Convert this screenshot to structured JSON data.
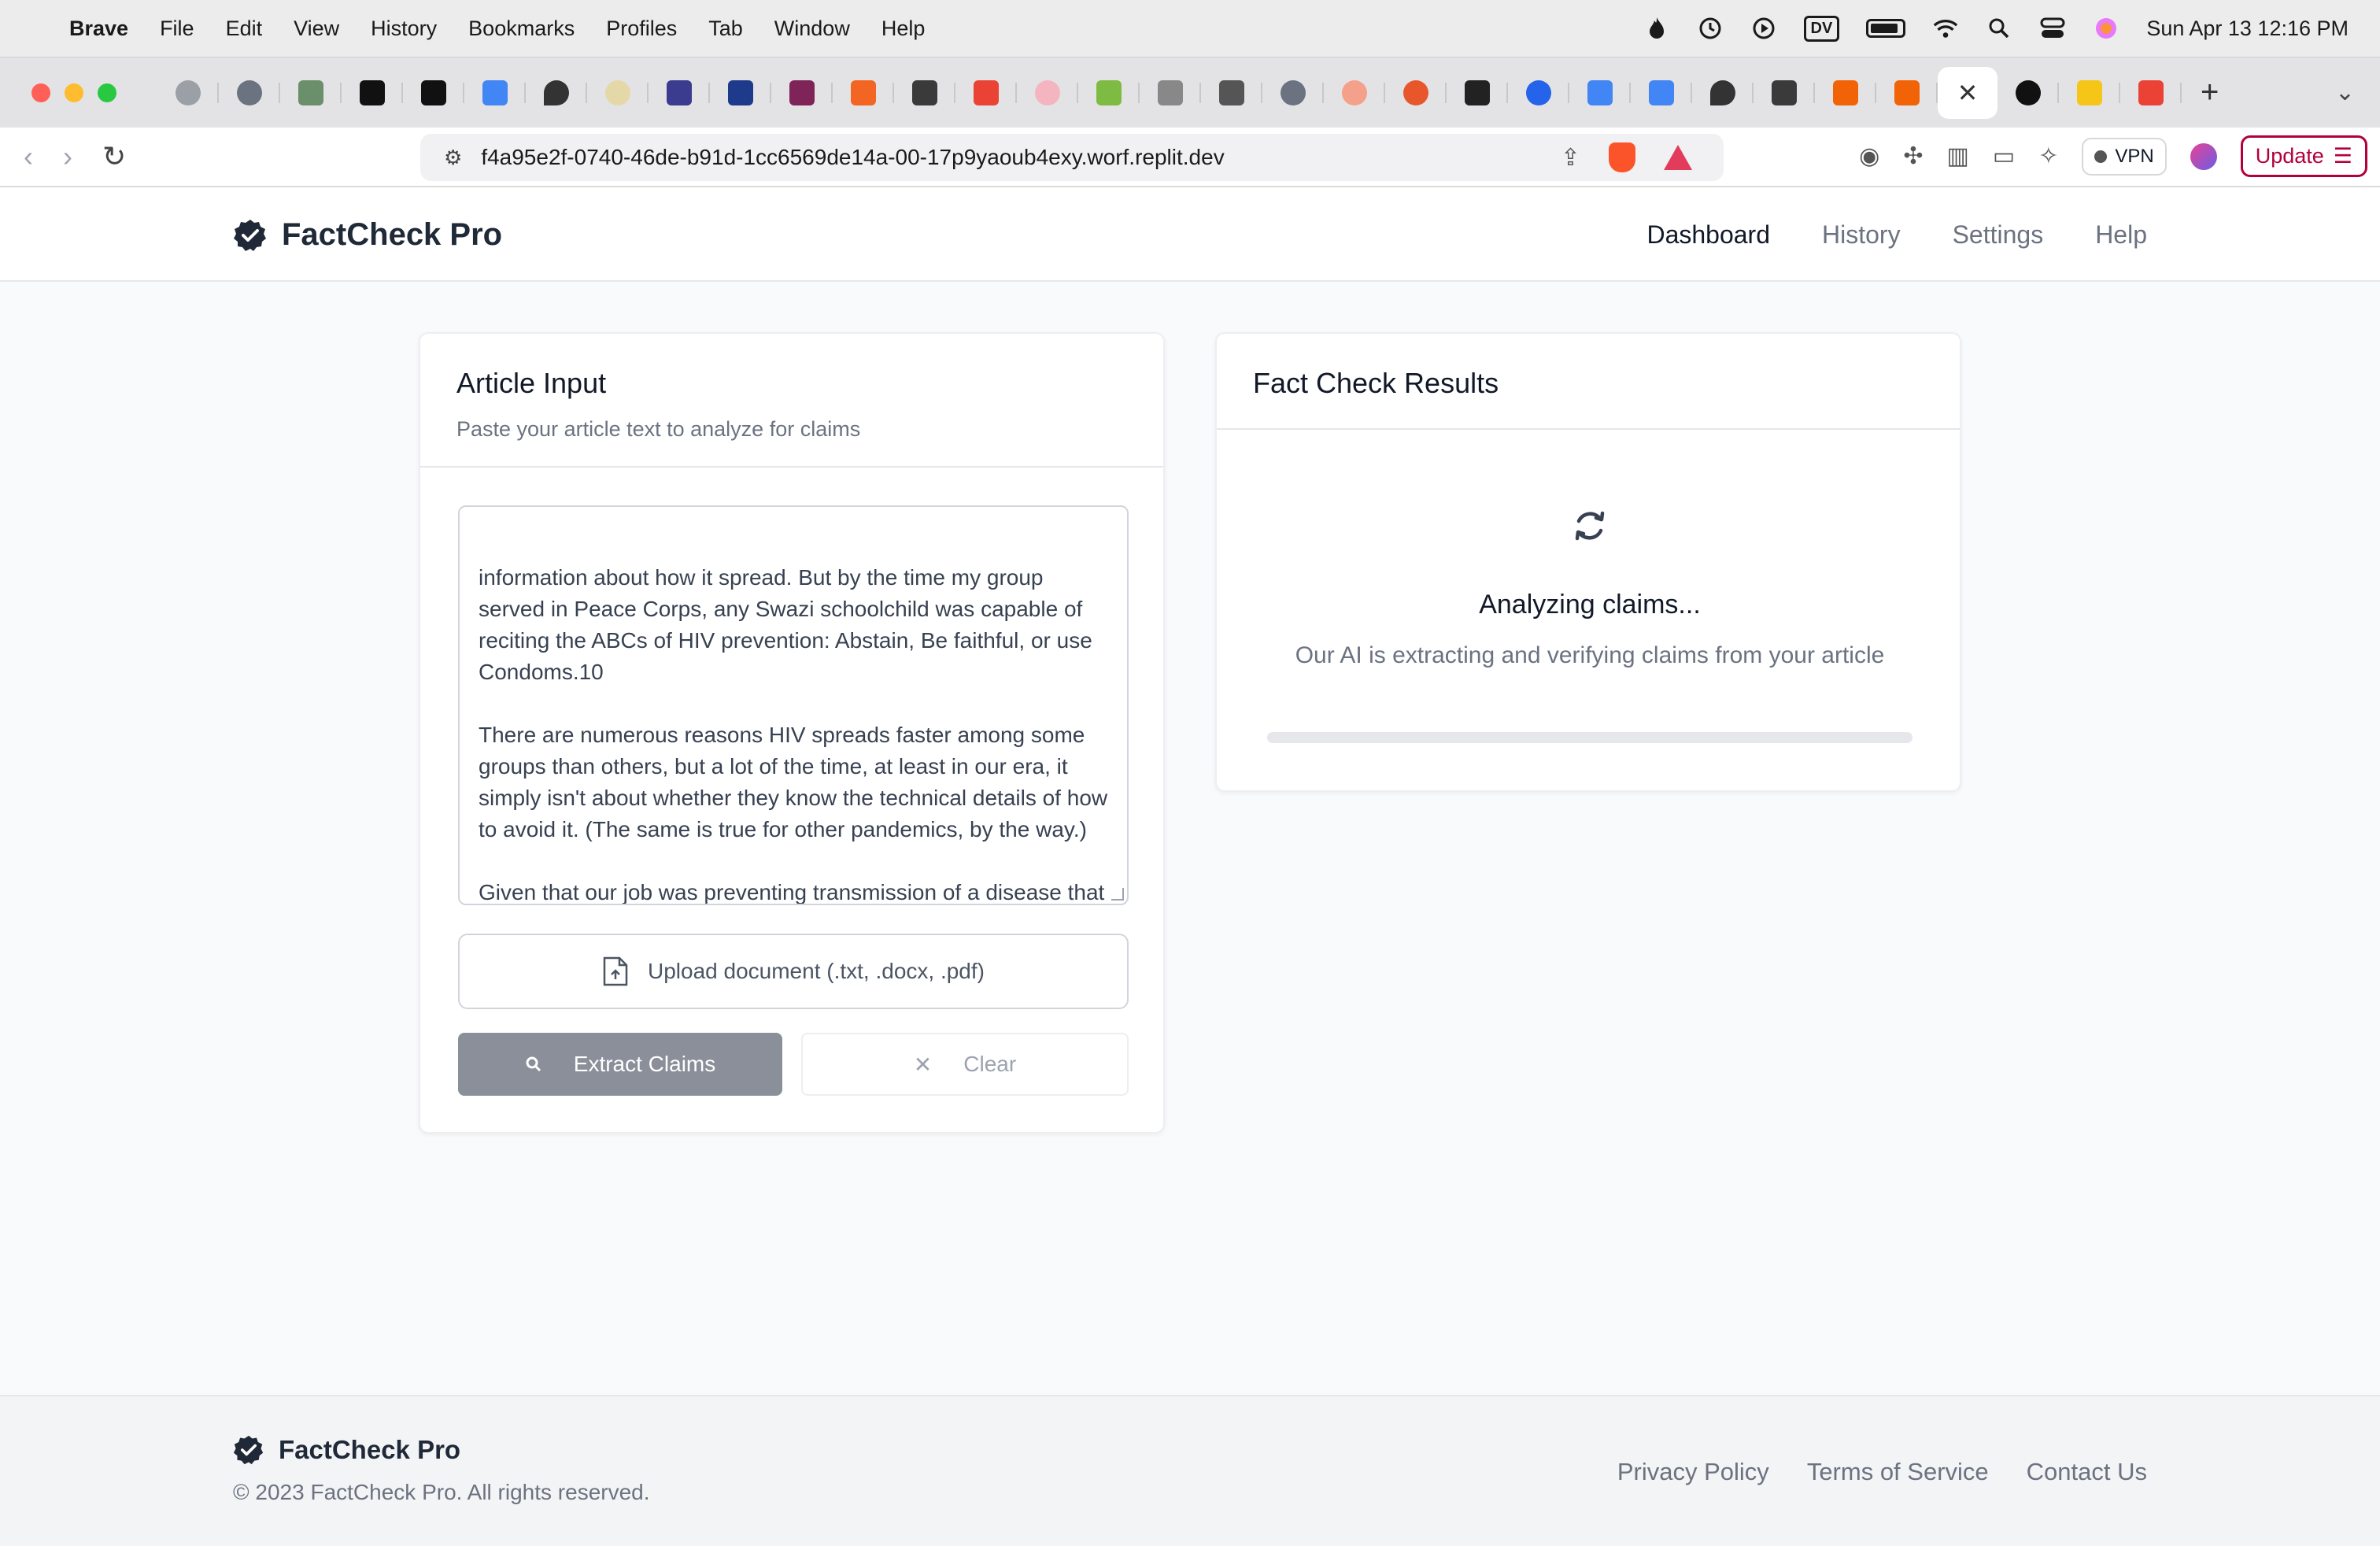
{
  "menubar": {
    "app_name": "Brave",
    "items": [
      "File",
      "Edit",
      "View",
      "History",
      "Bookmarks",
      "Profiles",
      "Tab",
      "Window",
      "Help"
    ],
    "dv_label": "DV",
    "clock": "Sun Apr 13  12:16 PM"
  },
  "browser": {
    "url": "f4a95e2f-0740-46de-b91d-1cc6569de14a-00-17p9yaoub4exy.worf.replit.dev",
    "vpn_label": "VPN",
    "update_label": "Update"
  },
  "app": {
    "brand": "FactCheck Pro",
    "nav": [
      "Dashboard",
      "History",
      "Settings",
      "Help"
    ]
  },
  "input_card": {
    "title": "Article Input",
    "subtitle": "Paste your article text to analyze for claims",
    "article_text": "information about how it spread. But by the time my group served in Peace Corps, any Swazi schoolchild was capable of reciting the ABCs of HIV prevention: Abstain, Be faithful, or use Condoms.10\n\nThere are numerous reasons HIV spreads faster among some groups than others, but a lot of the time, at least in our era, it simply isn't about whether they know the technical details of how to avoid it. (The same is true for other pandemics, by the way.)\n\nGiven that our job was preventing transmission of a disease that was completely intertwined with sex and gender, which is",
    "upload_label": "Upload document (.txt, .docx, .pdf)",
    "extract_label": "Extract Claims",
    "clear_label": "Clear"
  },
  "results_card": {
    "title": "Fact Check Results",
    "status_title": "Analyzing claims...",
    "status_subtitle": "Our AI is extracting and verifying claims from your article",
    "progress": 0
  },
  "footer": {
    "brand": "FactCheck Pro",
    "copyright": "© 2023 FactCheck Pro. All rights reserved.",
    "links": [
      "Privacy Policy",
      "Terms of Service",
      "Contact Us"
    ]
  },
  "colors": {
    "extract_button": "#8a8f99",
    "update_accent": "#b3003c",
    "background": "#f9fafb"
  }
}
